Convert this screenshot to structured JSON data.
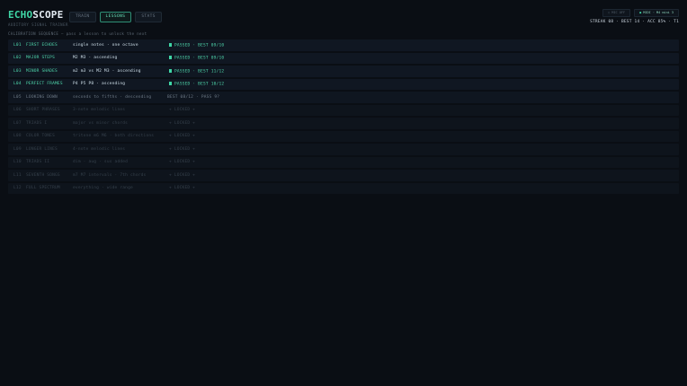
{
  "brand": {
    "part1": "ECHO",
    "part2": "SCOPE",
    "subtitle": "AUDITORY SIGNAL TRAINER"
  },
  "tabs": [
    {
      "label": "TRAIN",
      "active": false
    },
    {
      "label": "LESSONS",
      "active": true
    },
    {
      "label": "STATS",
      "active": false
    }
  ],
  "top_right": {
    "mic_label": "○ MIC OFF",
    "midi_label": "MIDI · M4 mini 3",
    "midi_dot": "●",
    "stats": "STREAK 08 · BEST 14 · ACC 85% · T1"
  },
  "sequence_label": "CALIBRATION SEQUENCE — pass a lesson to unlock the next",
  "lessons": [
    {
      "code": "L01",
      "name": "FIRST ECHOES",
      "desc": "single notes · one octave",
      "status": "PASSED · BEST 09/10",
      "state": "passed"
    },
    {
      "code": "L02",
      "name": "MAJOR STEPS",
      "desc": "M2 M3 · ascending",
      "status": "PASSED · BEST 09/10",
      "state": "passed"
    },
    {
      "code": "L03",
      "name": "MINOR SHADES",
      "desc": "m2 m3 vs M2 M3 · ascending",
      "status": "PASSED · BEST 11/12",
      "state": "passed"
    },
    {
      "code": "L04",
      "name": "PERFECT FRAMES",
      "desc": "P4 P5 P8 · ascending",
      "status": "PASSED · BEST 10/12",
      "state": "passed"
    },
    {
      "code": "L05",
      "name": "LOOKING DOWN",
      "desc": "seconds to fifths · descending",
      "status": "BEST 08/12 · PASS 9?",
      "state": "current"
    },
    {
      "code": "L06",
      "name": "SHORT PHRASES",
      "desc": "3-note melodic lines",
      "status": "+ LOCKED +",
      "state": "locked"
    },
    {
      "code": "L07",
      "name": "TRIADS I",
      "desc": "major vs minor chords",
      "status": "+ LOCKED +",
      "state": "locked"
    },
    {
      "code": "L08",
      "name": "COLOR TONES",
      "desc": "tritone m6 M6 · both directions",
      "status": "+ LOCKED +",
      "state": "locked"
    },
    {
      "code": "L09",
      "name": "LONGER LINES",
      "desc": "4-note melodic lines",
      "status": "+ LOCKED +",
      "state": "locked"
    },
    {
      "code": "L10",
      "name": "TRIADS II",
      "desc": "dim · aug · sus added",
      "status": "+ LOCKED +",
      "state": "locked"
    },
    {
      "code": "L11",
      "name": "SEVENTH SONGS",
      "desc": "m7 M7 intervals · 7th chords",
      "status": "+ LOCKED +",
      "state": "locked"
    },
    {
      "code": "L12",
      "name": "FULL SPECTRUM",
      "desc": "everything · wide range",
      "status": "+ LOCKED +",
      "state": "locked"
    }
  ]
}
